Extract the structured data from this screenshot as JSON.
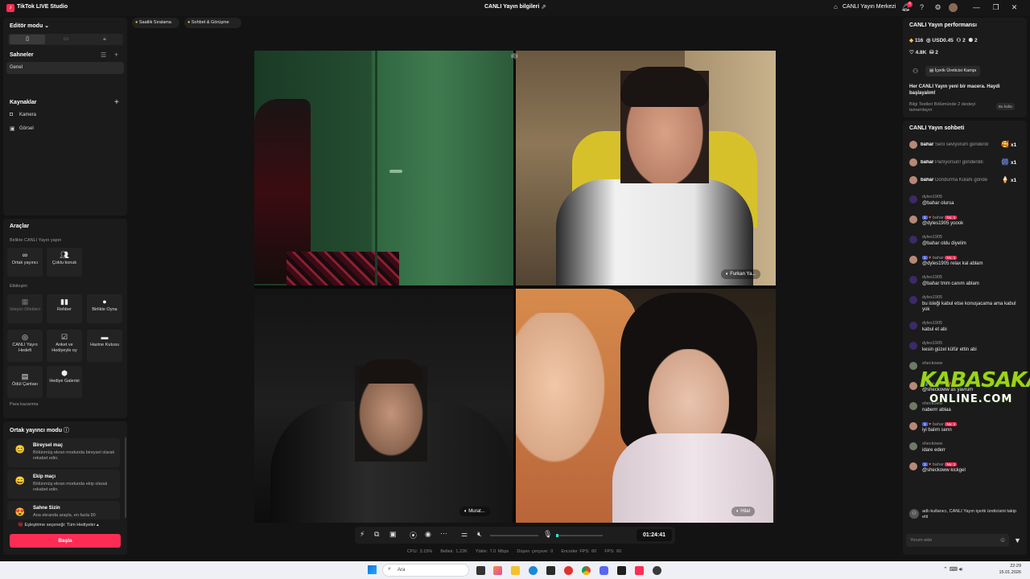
{
  "window": {
    "app_title": "TikTok LIVE Studio",
    "center_title": "CANLI Yayın bilgileri",
    "live_center": "CANLI Yayın Merkezi",
    "notif_count": "4"
  },
  "left": {
    "editor_mode": "Editör modu",
    "scenes_title": "Sahneler",
    "scene_general": "Genel",
    "sources_title": "Kaynaklar",
    "sources": [
      "Kamera",
      "Görsel"
    ],
    "tools_title": "Araçlar",
    "cohost_section": "Birlikte CANLI Yayın yapın",
    "tools_row1": [
      "Ortak yayıncı",
      "Çoklu konuk"
    ],
    "interaction_section": "Etkileşim",
    "tools_row2": [
      "Izleyici Dilekleri",
      "Rehber",
      "Birlikte Oyna"
    ],
    "tools_row3": [
      "CANLI Yayın Hedefi",
      "Anket ve Hediyeyle oy",
      "Hazine Kutusu"
    ],
    "tools_row4": [
      "Ödül Çantası",
      "Hediye Galerisi"
    ],
    "earn_section": "Para kazanma",
    "cohost_mode_title": "Ortak yayıncı modu",
    "modes": [
      {
        "title": "Bireysel maç",
        "desc": "Bölünmüş ekran modunda bireysel olarak rekabet edin."
      },
      {
        "title": "Ekip maçı",
        "desc": "Bölünmüş ekran modunda ekip olarak rekabet edin."
      },
      {
        "title": "Sahne Sizin",
        "desc": "Ana ekranda arayla, en fazla 90"
      }
    ],
    "match_option": "Eşleştirme seçeneği: Tüm Hediyeler",
    "start_button": "Başla"
  },
  "topbar": {
    "ranking": "Saatlik Sıralama",
    "chat_meet": "Sohbet & Görüşme"
  },
  "videos": [
    {
      "label": ""
    },
    {
      "label": "Furkan Ya..."
    },
    {
      "label": "Murat..."
    },
    {
      "label": "Hilal"
    }
  ],
  "controls": {
    "timer": "01:24:41"
  },
  "stats": {
    "cpu": "CPU: 3.15%",
    "memory": "Bellek: 1.22K",
    "upload": "Yükle: 7.0 Mbps",
    "dropped": "Düşen çerçeve: 0",
    "encoder_fps": "Encoder FPS: 60",
    "fps": "FPS: 60"
  },
  "performance": {
    "title": "CANLI Yayın performansı",
    "diamonds": "116",
    "usd": "USD0.45",
    "viewers": "2",
    "guests": "2",
    "likes": "4.8K",
    "gifters": "2",
    "creator_camp": "İçerik Üreticisi Kampı",
    "adventure": "Her CANLI Yayın yeni bir macera. Haydi başlayalım!",
    "knowledge": "Bilgi Testleri Bölümünde 2 desteyi tamamlayın",
    "this_week": "Bu hafta"
  },
  "chat": {
    "title": "CANLI Yayın sohbeti",
    "gifts": [
      {
        "user": "bahar",
        "text": "Seni seviyorum gönderdi",
        "count": "x1",
        "icon": "🥰"
      },
      {
        "user": "bahar",
        "text": "Parlıyorsun! gönderildi",
        "count": "x1",
        "icon": "🎆"
      },
      {
        "user": "bahar",
        "text": "Dondurma Külahı gönde",
        "count": "x1",
        "icon": "🍦"
      }
    ],
    "messages": [
      {
        "user": "dyles1905",
        "text": "@bahar olursa",
        "badges": false
      },
      {
        "user": "bahar",
        "text": "@dyles1905 yoook",
        "badges": true
      },
      {
        "user": "dyles1905",
        "text": "@bahar oldu diyelim",
        "badges": false
      },
      {
        "user": "bahar",
        "text": "@dyles1905 relax kal ablam",
        "badges": true
      },
      {
        "user": "dyles1905",
        "text": "@bahar tmm canım ablam",
        "badges": false
      },
      {
        "user": "dyles1905",
        "text": "bu isteği kabul etse konuşacama ama kabul yok",
        "badges": false
      },
      {
        "user": "dyles1905",
        "text": "kabul et abi",
        "badges": false
      },
      {
        "user": "dyles1905",
        "text": "kesin güzel küfür ettin abi",
        "badges": false
      },
      {
        "user": "sheckoww",
        "text": "",
        "badges": false
      },
      {
        "user": "bahar",
        "text": "@sheckoww as yavrum",
        "badges": true
      },
      {
        "user": "sheckoww",
        "text": "naberrr ablaa",
        "badges": false
      },
      {
        "user": "bahar",
        "text": "iyi balım senn",
        "badges": true
      },
      {
        "user": "sheckoww",
        "text": "idare ederr",
        "badges": false
      },
      {
        "user": "bahar",
        "text": "@sheckoww kickgel",
        "badges": true
      }
    ],
    "badge_no1": "No. 1",
    "badge_level": "1",
    "follow_notice": "adlı kullanıcı, CANLI Yayın içerik üreticisini takip etti",
    "input_placeholder": "Yorum ekle"
  },
  "watermark": {
    "line1": "KABASAKAL",
    "line2": "ONLINE.COM"
  },
  "taskbar": {
    "search": "Ara",
    "time": "22:29",
    "date": "15.01.2026"
  },
  "colors": {
    "accent": "#fe2c55",
    "panel": "#1b1b1b",
    "background": "#131313"
  }
}
